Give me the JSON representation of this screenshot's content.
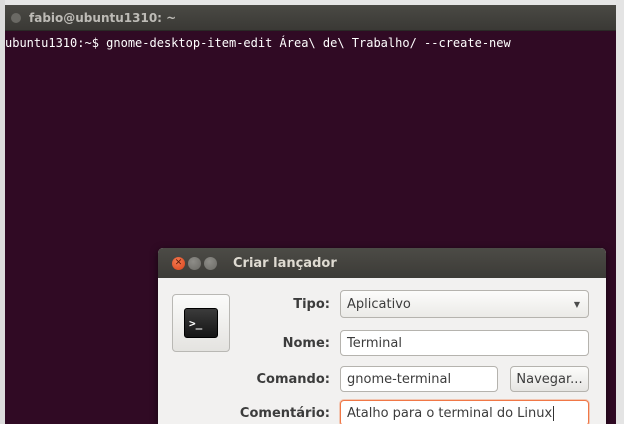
{
  "terminal": {
    "title": "fabio@ubuntu1310: ~",
    "command_line": "ubuntu1310:~$ gnome-desktop-item-edit Área\\ de\\ Trabalho/ --create-new"
  },
  "dialog": {
    "title": "Criar lançador",
    "icon": "terminal-icon",
    "icon_glyph": ">_",
    "fields": {
      "type_label": "Tipo:",
      "type_value": "Aplicativo",
      "name_label": "Nome:",
      "name_value": "Terminal",
      "command_label": "Comando:",
      "command_value": "gnome-terminal",
      "browse_label": "Navegar...",
      "comment_label": "Comentário:",
      "comment_value": "Atalho para o terminal do Linux"
    }
  },
  "colors": {
    "terminal_bg": "#300a24",
    "close_button": "#e6552b",
    "focus_border": "#f07746"
  }
}
